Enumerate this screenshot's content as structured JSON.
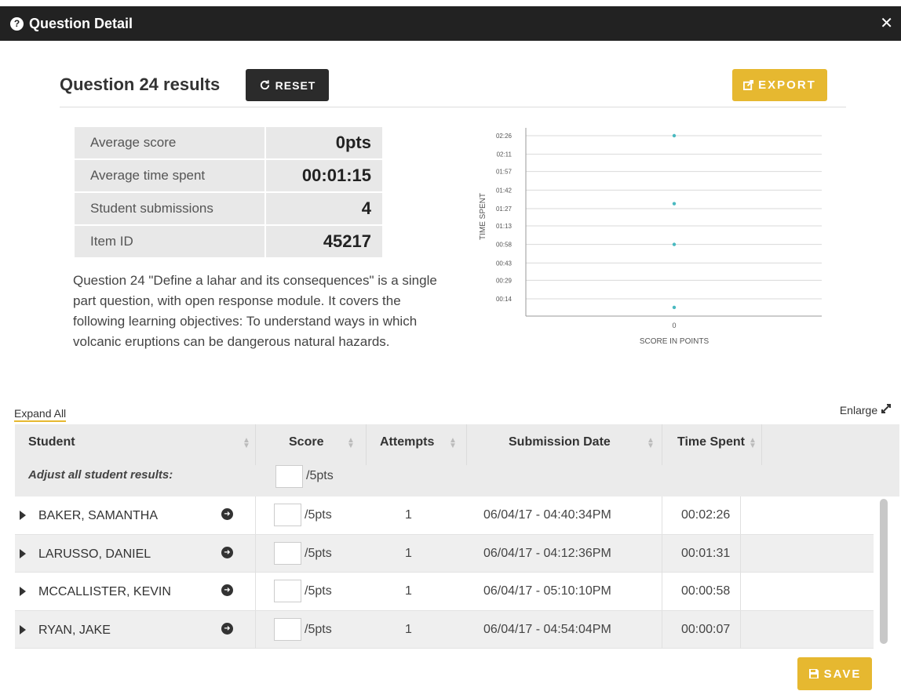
{
  "window": {
    "title": "Question Detail",
    "close": "✕"
  },
  "header": {
    "title": "Question 24 results",
    "reset_label": "RESET",
    "export_label": "EXPORT"
  },
  "stats": [
    {
      "label": "Average score",
      "value": "0pts"
    },
    {
      "label": "Average time spent",
      "value": "00:01:15"
    },
    {
      "label": "Student submissions",
      "value": "4"
    },
    {
      "label": "Item ID",
      "value": "45217"
    }
  ],
  "description": "Question 24 \"Define a lahar and its consequences\" is a single part question, with open response module. It covers the following learning objectives: To understand ways in which volcanic eruptions can be dangerous natural hazards.",
  "chart_data": {
    "type": "scatter",
    "xlabel": "SCORE IN POINTS",
    "ylabel": "TIME SPENT",
    "x_ticks": [
      "0"
    ],
    "y_ticks": [
      "00:14",
      "00:29",
      "00:43",
      "00:58",
      "01:13",
      "01:27",
      "01:42",
      "01:57",
      "02:11",
      "02:26"
    ],
    "ylim_seconds": [
      0,
      146
    ],
    "points": [
      {
        "x": 0,
        "y": "02:26",
        "y_seconds": 146
      },
      {
        "x": 0,
        "y": "01:31",
        "y_seconds": 91
      },
      {
        "x": 0,
        "y": "00:58",
        "y_seconds": 58
      },
      {
        "x": 0,
        "y": "00:07",
        "y_seconds": 7
      }
    ],
    "grid": true,
    "point_color": "#4ab9c0"
  },
  "table": {
    "expand_all": "Expand All",
    "enlarge": "Enlarge",
    "columns": [
      "Student",
      "Score",
      "Attempts",
      "Submission Date",
      "Time Spent"
    ],
    "adjust_label": "Adjust all student results:",
    "pts_suffix": "/5pts",
    "rows": [
      {
        "name": "BAKER, SAMANTHA",
        "pts": "/5pts",
        "attempts": "1",
        "date": "06/04/17 - 04:40:34PM",
        "time": "00:02:26"
      },
      {
        "name": "LARUSSO, DANIEL",
        "pts": "/5pts",
        "attempts": "1",
        "date": "06/04/17 - 04:12:36PM",
        "time": "00:01:31"
      },
      {
        "name": "MCCALLISTER, KEVIN",
        "pts": "/5pts",
        "attempts": "1",
        "date": "06/04/17 - 05:10:10PM",
        "time": "00:00:58"
      },
      {
        "name": "RYAN, JAKE",
        "pts": "/5pts",
        "attempts": "1",
        "date": "06/04/17 - 04:54:04PM",
        "time": "00:00:07"
      }
    ]
  },
  "footer": {
    "save_label": "SAVE"
  },
  "colors": {
    "accent": "#e6b830",
    "dark": "#2b2b2b",
    "topbar": "#222222"
  }
}
